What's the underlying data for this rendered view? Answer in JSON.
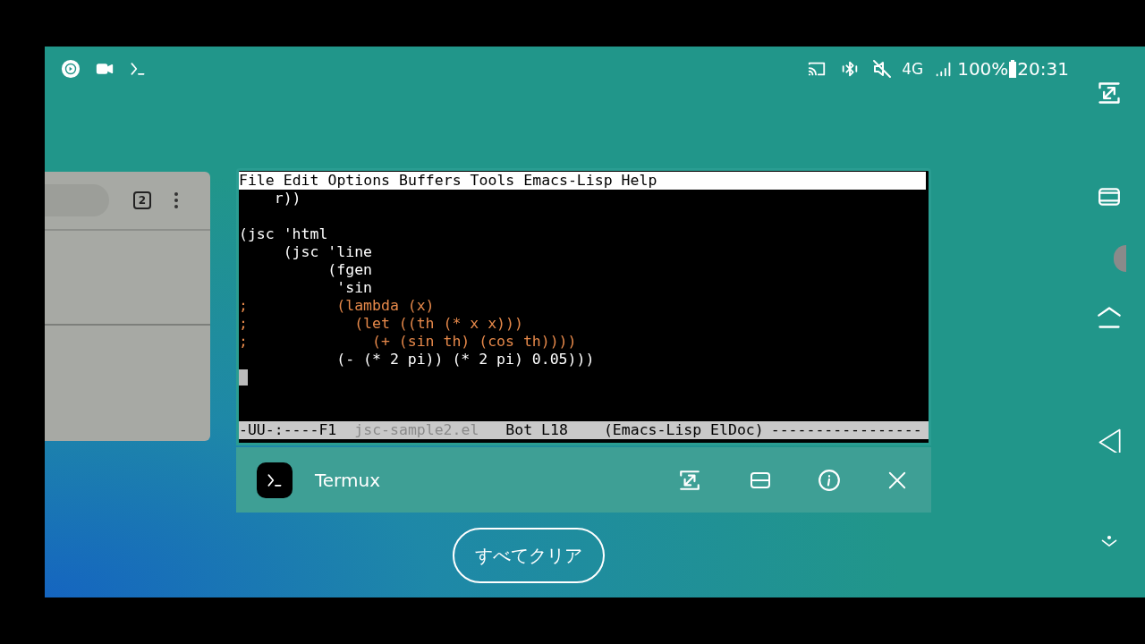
{
  "status_bar": {
    "battery": "100%",
    "time": "20:31",
    "network": "4G"
  },
  "left_card": {
    "tab_count": "2"
  },
  "terminal": {
    "menu": [
      "File",
      "Edit",
      "Options",
      "Buffers",
      "Tools",
      "Emacs-Lisp",
      "Help"
    ],
    "lines": [
      {
        "kind": "code",
        "text": "    r))"
      },
      {
        "kind": "blank"
      },
      {
        "kind": "code",
        "text": "(jsc 'html"
      },
      {
        "kind": "code",
        "text": "     (jsc 'line"
      },
      {
        "kind": "code",
        "text": "          (fgen"
      },
      {
        "kind": "code",
        "text": "           'sin"
      },
      {
        "kind": "comment",
        "text": ";          (lambda (x)"
      },
      {
        "kind": "comment",
        "text": ";            (let ((th (* x x)))"
      },
      {
        "kind": "comment",
        "text": ";              (+ (sin th) (cos th))))"
      },
      {
        "kind": "code",
        "text": "           (- (* 2 pi)) (* 2 pi) 0.05)))"
      },
      {
        "kind": "cursor"
      }
    ],
    "mode_line": {
      "status": "-UU-:----F1",
      "file": "jsc-sample2.el",
      "position": "Bot L18",
      "mode": "(Emacs-Lisp ElDoc)",
      "fill": "-----------------"
    }
  },
  "app_bar": {
    "name": "Termux"
  },
  "clear_all": "すべてクリア"
}
